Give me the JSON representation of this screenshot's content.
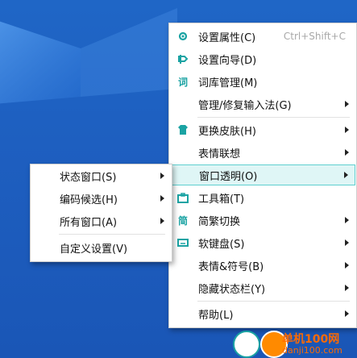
{
  "colors": {
    "desktop": "#1e5fc0",
    "accent": "#1aa3a3",
    "highlight_bg": "#dff6f6",
    "highlight_border": "#5fd0d0"
  },
  "main_menu": {
    "items": [
      {
        "icon": "gear-icon",
        "label": "设置属性(C)",
        "shortcut": "Ctrl+Shift+C"
      },
      {
        "icon": "guide-icon",
        "label": "设置向导(D)"
      },
      {
        "icon": "dictionary-icon",
        "label": "词库管理(M)"
      },
      {
        "label": "管理/修复输入法(G)"
      },
      {
        "icon": "shirt-icon",
        "label": "更换皮肤(H)"
      },
      {
        "label": "表情联想"
      },
      {
        "label": "窗口透明(O)"
      },
      {
        "icon": "toolbox-icon",
        "label": "工具箱(T)"
      },
      {
        "icon": "traditional-icon",
        "label": "简繁切换"
      },
      {
        "icon": "keyboard-icon",
        "label": "软键盘(S)"
      },
      {
        "label": "表情&符号(B)"
      },
      {
        "label": "隐藏状态栏(Y)"
      },
      {
        "label": "帮助(L)"
      }
    ]
  },
  "sub_menu": {
    "items": [
      {
        "label": "状态窗口(S)"
      },
      {
        "label": "编码候选(H)"
      },
      {
        "label": "所有窗口(A)"
      },
      {
        "label": "自定义设置(V)"
      }
    ]
  },
  "watermark": {
    "text": "单机100网",
    "url_text": "danji100.com"
  }
}
